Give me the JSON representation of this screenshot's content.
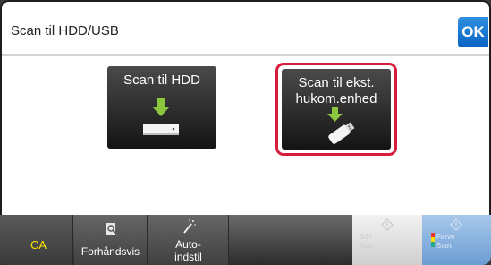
{
  "header": {
    "title": "Scan til HDD/USB",
    "ok_label": "OK"
  },
  "options": [
    {
      "label": "Scan til HDD",
      "icon": "hdd-download-icon",
      "selected": false
    },
    {
      "label": "Scan til ekst. hukom.enhed",
      "label_lines": [
        "Scan til ekst.",
        "hukom.enhed"
      ],
      "icon": "usb-download-icon",
      "selected": true
    }
  ],
  "bottombar": {
    "ca_label": "CA",
    "preview_label": "Forhåndsvis",
    "auto_label_lines": [
      "Auto-",
      "indstil"
    ],
    "bw_start_label": "S/H",
    "bw_start_sub": "Start",
    "color_start_label": "Farve",
    "color_start_sub": "Start"
  },
  "colors": {
    "ok_blue": "#0a64c2",
    "selected_frame": "#d71d3a",
    "ca_text": "#f5e400",
    "download_arrow": "#8cc63f"
  }
}
